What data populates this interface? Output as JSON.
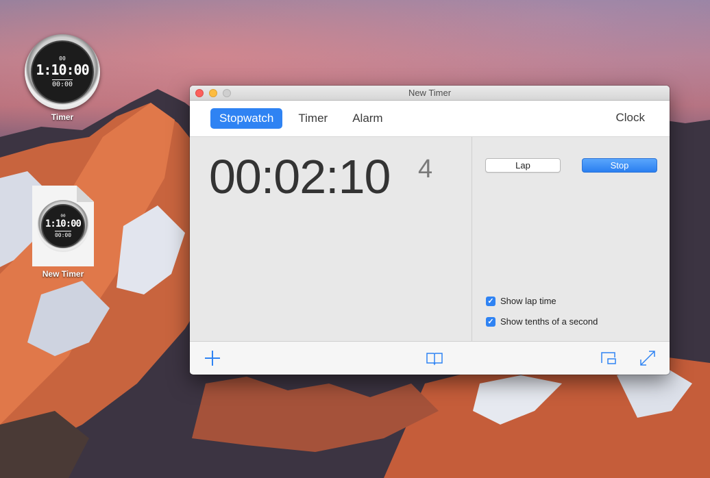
{
  "desktop": {
    "icons": [
      {
        "label": "Timer",
        "face_big": "1:10:00",
        "face_small": "00:00",
        "face_top": "00"
      },
      {
        "label": "New Timer",
        "face_big": "1:10:00",
        "face_small": "00:00",
        "face_top": "00"
      }
    ]
  },
  "window": {
    "title": "New Timer",
    "tabs": [
      {
        "label": "Stopwatch",
        "active": true
      },
      {
        "label": "Timer",
        "active": false
      },
      {
        "label": "Alarm",
        "active": false
      }
    ],
    "clock_tab": "Clock",
    "stopwatch": {
      "time": "00:02:10",
      "tenths": "4"
    },
    "buttons": {
      "lap": "Lap",
      "stop": "Stop"
    },
    "options": [
      {
        "label": "Show lap time",
        "checked": true
      },
      {
        "label": "Show tenths of a second",
        "checked": true
      }
    ],
    "bottom_icons": [
      "plus-icon",
      "book-icon",
      "picture-in-picture-icon",
      "expand-icon"
    ]
  },
  "colors": {
    "accent": "#2f83f3",
    "close": "#fc605c",
    "minimize": "#fdbc40"
  }
}
